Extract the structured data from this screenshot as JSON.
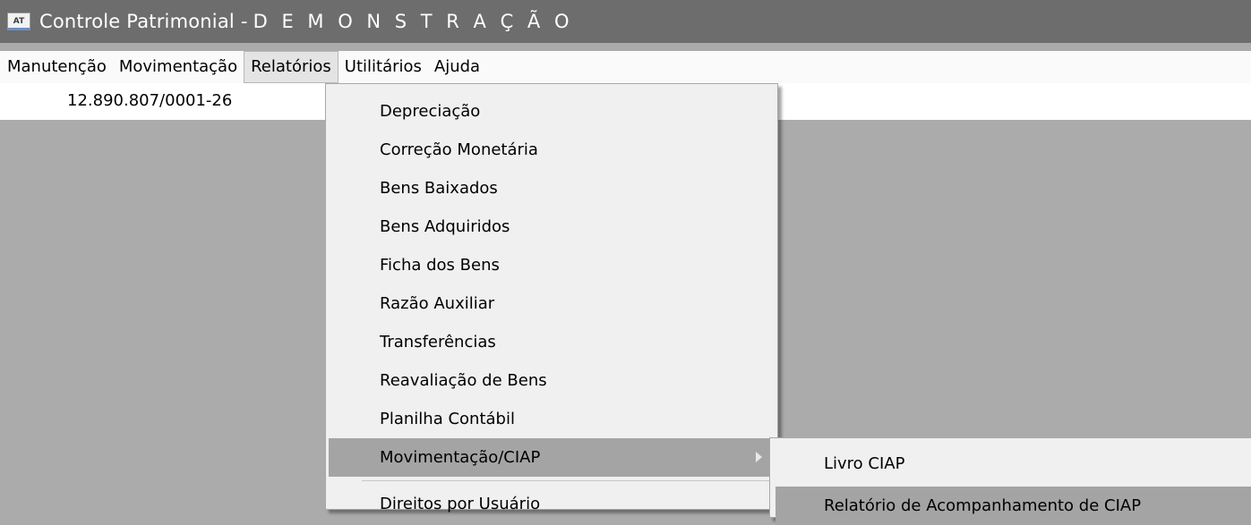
{
  "window": {
    "icon_text": "AT",
    "title": "Controle Patrimonial -",
    "title_mode": "D E M O N S T R A Ç Ã O"
  },
  "menubar": {
    "items": [
      "Manutenção",
      "Movimentação",
      "Relatórios",
      "Utilitários",
      "Ajuda"
    ]
  },
  "info": {
    "cnpj": "12.890.807/0001-26"
  },
  "relatorios_menu": {
    "items": [
      "Depreciação",
      "Correção Monetária",
      "Bens Baixados",
      "Bens Adquiridos",
      "Ficha dos Bens",
      "Razão Auxiliar",
      "Transferências",
      "Reavaliação de Bens",
      "Planilha Contábil",
      "Movimentação/CIAP",
      "Direitos por Usuário"
    ]
  },
  "ciap_submenu": {
    "items": [
      "Livro CIAP",
      "Relatório de Acompanhamento de CIAP"
    ]
  }
}
